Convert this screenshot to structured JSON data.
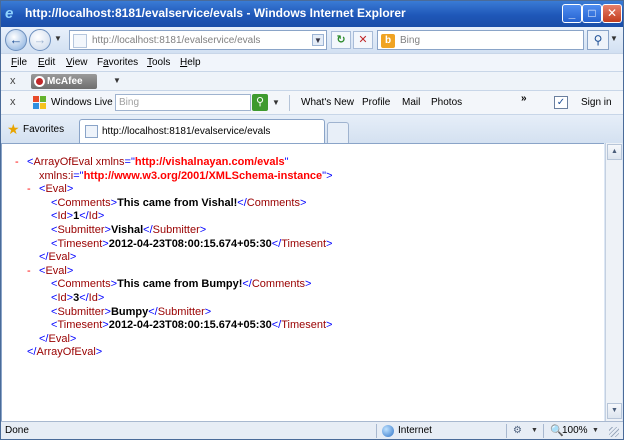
{
  "window": {
    "title": "http://localhost:8181/evalservice/evals - Windows Internet Explorer",
    "minimize": "_",
    "maximize": "□",
    "close": "✕"
  },
  "address_bar": {
    "url": "http://localhost:8181/evalservice/evals",
    "search_placeholder": "Bing",
    "back_icon": "←",
    "forward_icon": "→",
    "refresh_icon": "↻",
    "stop_icon": "✕",
    "search_go_icon": "⚲"
  },
  "menu": {
    "items": [
      "File",
      "Edit",
      "View",
      "Favorites",
      "Tools",
      "Help"
    ],
    "underline": [
      "F",
      "E",
      "V",
      "a",
      "T",
      "H"
    ]
  },
  "mcafee_bar": {
    "close": "x",
    "label": "McAfee"
  },
  "live_bar": {
    "close": "x",
    "label": "Windows Live",
    "search_placeholder": "Bing",
    "links": [
      "What's New",
      "Profile",
      "Mail",
      "Photos"
    ],
    "more": "»",
    "sign_in": "Sign in"
  },
  "favorites_bar": {
    "favorites_label": "Favorites",
    "tab_label": "http://localhost:8181/evalservice/evals"
  },
  "xml": {
    "root_tag": "ArrayOfEval",
    "xmlns_attr": "xmlns",
    "xmlns_value": "http://vishalnayan.com/evals",
    "xmlns_i_attr": "xmlns:i",
    "xmlns_i_value": "http://www.w3.org/2001/XMLSchema-instance",
    "eval_tag": "Eval",
    "field_tags": {
      "comments": "Comments",
      "id": "Id",
      "submitter": "Submitter",
      "timesent": "Timesent"
    },
    "evals": [
      {
        "comments": "This came from Vishal!",
        "id": "1",
        "submitter": "Vishal",
        "timesent": "2012-04-23T08:00:15.674+05:30"
      },
      {
        "comments": "This came from Bumpy!",
        "id": "3",
        "submitter": "Bumpy",
        "timesent": "2012-04-23T08:00:15.674+05:30"
      }
    ]
  },
  "status_bar": {
    "status": "Done",
    "zone": "Internet",
    "zoom": "100%"
  }
}
